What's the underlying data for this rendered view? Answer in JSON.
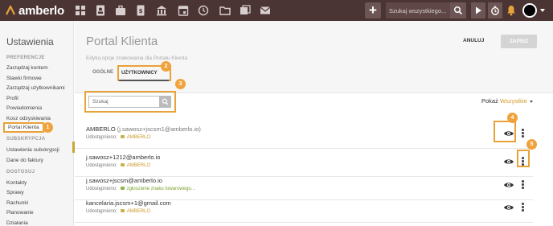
{
  "app": {
    "logo_text": "amberlo",
    "brand_color": "#e8a23a",
    "topbar_color": "#4a3534"
  },
  "topbar": {
    "icons": [
      "grid-icon",
      "contacts-icon",
      "briefcase-icon",
      "document-icon",
      "bank-icon",
      "calendar-icon",
      "history-icon",
      "folder-icon",
      "stack-icon",
      "mail-icon"
    ],
    "search_placeholder": "Szukaj wszystkiego..."
  },
  "sidebar": {
    "title": "Ustawienia",
    "sections": [
      {
        "heading": "PREFERENCJE",
        "items": [
          "Zarządzaj kontem",
          "Stawki firmowe",
          "Zarządzaj użytkownikami",
          "Profil",
          "Powiadomienia",
          "Kosz odzyskiwania",
          "Portal Klienta"
        ]
      },
      {
        "heading": "SUBSKRYPCJA",
        "items": [
          "Ustawienia subskrypcji",
          "Dane do faktury"
        ]
      },
      {
        "heading": "DOSTOSUJ",
        "items": [
          "Kontakty",
          "Sprawy",
          "Rachunki",
          "Planowanie",
          "Działania"
        ]
      }
    ],
    "active_item": "Portal Klienta"
  },
  "main": {
    "title": "Portal Klienta",
    "description": "Edytuj opcje znakowania dla Portalu Klienta",
    "cancel_label": "ANULUJ",
    "save_label": "ZAPISZ",
    "tabs": [
      {
        "label": "OGÓLNE"
      },
      {
        "label": "UŻYTKOWNICY"
      }
    ],
    "active_tab": "UŻYTKOWNICY",
    "search_placeholder": "Szukaj",
    "filter_label": "Pokaż",
    "filter_value": "Wszystkie",
    "shared_label": "Udostępniono:",
    "users": [
      {
        "name": "AMBERLO",
        "email": "(j.sawosz+jscsm1@amberlo.io)",
        "shared": "AMBERLO",
        "shared_type": "company"
      },
      {
        "name": "j.sawosz+1212@amberlo.io",
        "email": "",
        "shared": "AMBERLO",
        "shared_type": "company"
      },
      {
        "name": "j.sawosz+jscsm@amberlo.io",
        "email": "",
        "shared": "zgłoszenie znaku towarowego...",
        "shared_type": "matter"
      },
      {
        "name": "kancelaria.jscsm+1@gmail.com",
        "email": "",
        "shared": "AMBERLO",
        "shared_type": "company"
      }
    ]
  },
  "callouts": [
    "1",
    "2",
    "3",
    "4",
    "5"
  ]
}
